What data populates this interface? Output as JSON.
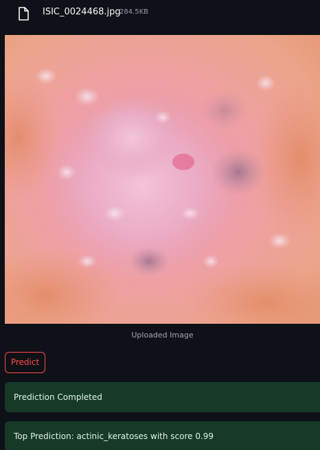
{
  "file": {
    "icon": "file-icon",
    "name": "ISIC_0024468.jpg",
    "size": "284.5KB"
  },
  "image": {
    "caption": "Uploaded Image"
  },
  "actions": {
    "predict_label": "Predict"
  },
  "messages": {
    "status": "Prediction Completed",
    "result": "Top Prediction: actinic_keratoses with score 0.99"
  },
  "colors": {
    "background": "#0e1117",
    "accent": "#ff4b4b",
    "success_bg": "#173928",
    "success_text": "#dff5e3"
  }
}
